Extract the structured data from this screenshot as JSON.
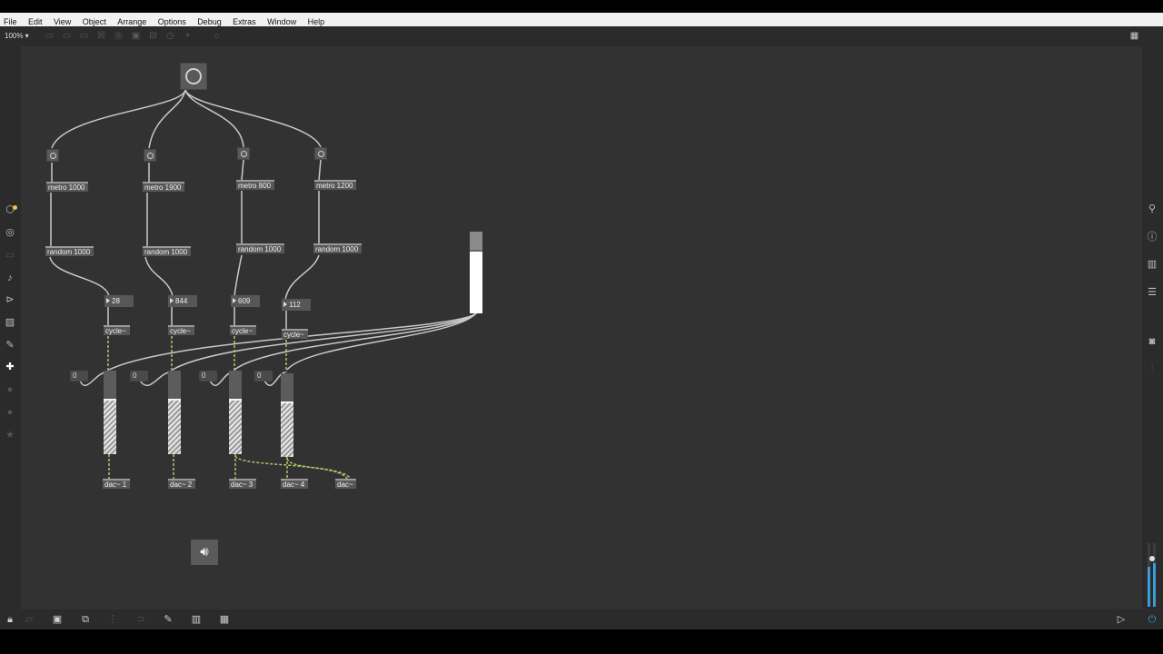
{
  "menu": [
    "File",
    "Edit",
    "View",
    "Object",
    "Arrange",
    "Options",
    "Debug",
    "Extras",
    "Window",
    "Help"
  ],
  "toolbar": {
    "zoom": "100% ▾"
  },
  "patch": {
    "metros": [
      "metro 1000",
      "metro 1900",
      "metro 800",
      "metro 1200"
    ],
    "randoms": [
      "random 1000",
      "random 1000",
      "random 1000",
      "random 1000"
    ],
    "numbers": [
      "28",
      "844",
      "609",
      "112"
    ],
    "cycles": [
      "cycle~",
      "cycle~",
      "cycle~",
      "cycle~"
    ],
    "floats": [
      "0",
      "0",
      "0",
      "0"
    ],
    "dacs": [
      "dac~ 1",
      "dac~ 2",
      "dac~ 3",
      "dac~ 4",
      "dac~"
    ],
    "slider_level": 0.78,
    "gain_levels": [
      0.66,
      0.66,
      0.66,
      0.66
    ]
  },
  "icons": {
    "left": [
      "package-icon",
      "target-icon",
      "window-icon",
      "music-note-icon",
      "presentation-icon",
      "image-icon",
      "paperclip-icon",
      "puzzle-icon",
      "circle-icon",
      "circle-icon",
      "star-icon"
    ],
    "right": [
      "search-icon",
      "info-icon",
      "book-icon",
      "list-icon",
      "camera-icon",
      "mixer-icon"
    ],
    "bottom": [
      "lock-icon",
      "edit-icon",
      "presentation-icon",
      "window-stack-icon",
      "grid-icon",
      "magnet-icon",
      "wrench-icon",
      "piano-icon",
      "dots-grid-icon"
    ]
  },
  "colors": {
    "canvas": "#323232",
    "chrome": "#2b2b2b",
    "signal_cord": "#a9c96a",
    "accent": "#f4c542",
    "meter": "#3a9bd5"
  }
}
